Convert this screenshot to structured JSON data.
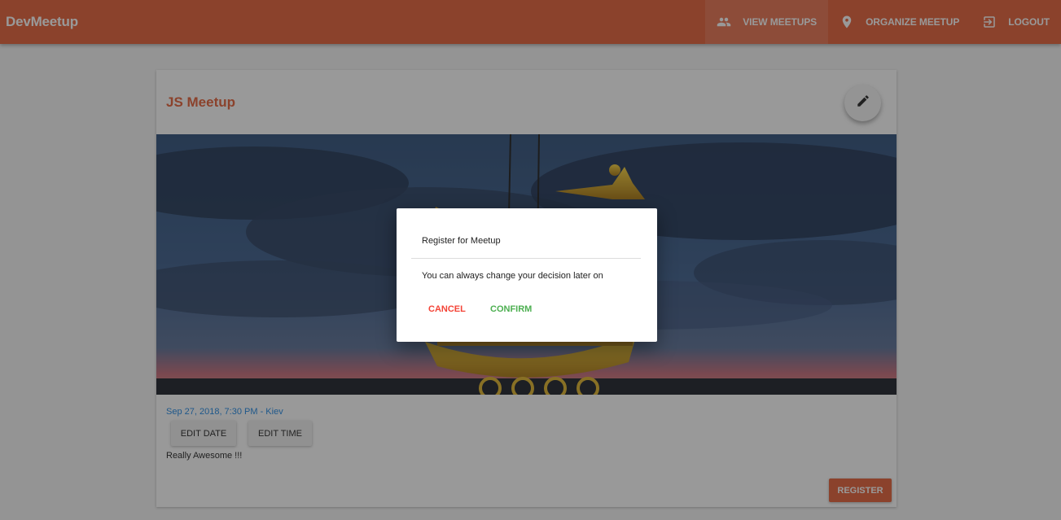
{
  "app": {
    "title": "DevMeetup"
  },
  "nav": {
    "items": [
      {
        "label": "VIEW MEETUPS",
        "icon": "people-icon"
      },
      {
        "label": "ORGANIZE MEETUP",
        "icon": "location-pin-icon"
      },
      {
        "label": "LOGOUT",
        "icon": "exit-icon"
      }
    ]
  },
  "meetup": {
    "title": "JS Meetup",
    "date_location": "Sep 27, 2018, 7:30 PM - Kiev",
    "edit_date_label": "EDIT DATE",
    "edit_time_label": "EDIT TIME",
    "description": "Really Awesome !!!",
    "register_label": "REGISTER"
  },
  "dialog": {
    "title": "Register for Meetup",
    "text": "You can always change your decision later on",
    "cancel_label": "CANCEL",
    "confirm_label": "CONFIRM"
  },
  "colors": {
    "primary": "#e65f36",
    "accent_blue": "#1e88e5",
    "cancel_red": "#f44336",
    "confirm_green": "#4caf50"
  }
}
